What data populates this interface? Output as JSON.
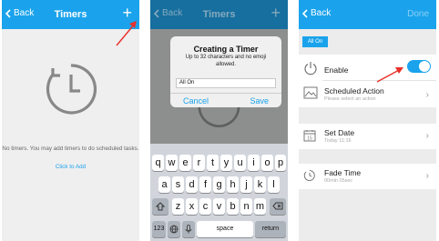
{
  "screen1": {
    "back": "Back",
    "title": "Timers",
    "add": "+",
    "empty_message": "No timers. You may add timers to do scheduled tasks.",
    "click_to_add": "Click to Add"
  },
  "screen2": {
    "back": "Back",
    "title": "Timers",
    "add": "+",
    "dialog": {
      "title": "Creating a Timer",
      "subtitle": "Up to 32 characters and no emoji allowed.",
      "input_value": "All On",
      "cancel": "Cancel",
      "save": "Save"
    },
    "keyboard": {
      "row1": [
        "q",
        "w",
        "e",
        "r",
        "t",
        "y",
        "u",
        "i",
        "o",
        "p"
      ],
      "row2": [
        "a",
        "s",
        "d",
        "f",
        "g",
        "h",
        "j",
        "k",
        "l"
      ],
      "row3": [
        "z",
        "x",
        "c",
        "v",
        "b",
        "n",
        "m"
      ],
      "numbers": "123",
      "space": "space",
      "return": "return"
    }
  },
  "screen3": {
    "back": "Back",
    "done": "Done",
    "timer_name": "All On",
    "enable_label": "Enable",
    "enable_on": true,
    "scheduled_action": "Scheduled Action",
    "scheduled_action_sub": "Please select an action",
    "set_date": "Set Date",
    "set_date_sub": "Today 11:16",
    "fade_time": "Fade Time",
    "fade_time_sub": "00min 05sec"
  },
  "colors": {
    "accent": "#1aa3ec",
    "annotation": "#e8302a"
  }
}
